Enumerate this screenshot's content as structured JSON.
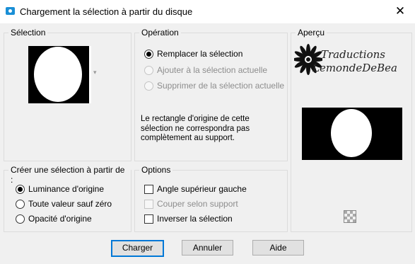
{
  "window": {
    "title": "Chargement la sélection à partir du disque",
    "close": "✕"
  },
  "selection_group": {
    "legend": "Sélection",
    "dropdown_arrow": "▾"
  },
  "operation_group": {
    "legend": "Opération",
    "options": [
      {
        "label": "Remplacer la sélection",
        "checked": true,
        "enabled": true
      },
      {
        "label": "Ajouter à la sélection actuelle",
        "checked": false,
        "enabled": false
      },
      {
        "label": "Supprimer de la sélection actuelle",
        "checked": false,
        "enabled": false
      }
    ],
    "note_lines": [
      "Le rectangle d'origine de cette",
      "sélection ne correspondra pas",
      "complètement au support."
    ]
  },
  "apercu_group": {
    "legend": "Aperçu",
    "watermark_line1": "Traductions",
    "watermark_line2": "LemondeDeBea"
  },
  "create_group": {
    "legend": "Créer une sélection à partir de :",
    "options": [
      {
        "label": "Luminance d'origine",
        "checked": true
      },
      {
        "label": "Toute valeur sauf zéro",
        "checked": false
      },
      {
        "label": "Opacité d'origine",
        "checked": false
      }
    ]
  },
  "options_group": {
    "legend": "Options",
    "checks": [
      {
        "label": "Angle supérieur gauche",
        "checked": false,
        "enabled": true
      },
      {
        "label": "Couper selon support",
        "checked": false,
        "enabled": false
      },
      {
        "label": "Inverser la sélection",
        "checked": false,
        "enabled": true
      }
    ]
  },
  "buttons": {
    "ok": "Charger",
    "cancel": "Annuler",
    "help": "Aide"
  }
}
